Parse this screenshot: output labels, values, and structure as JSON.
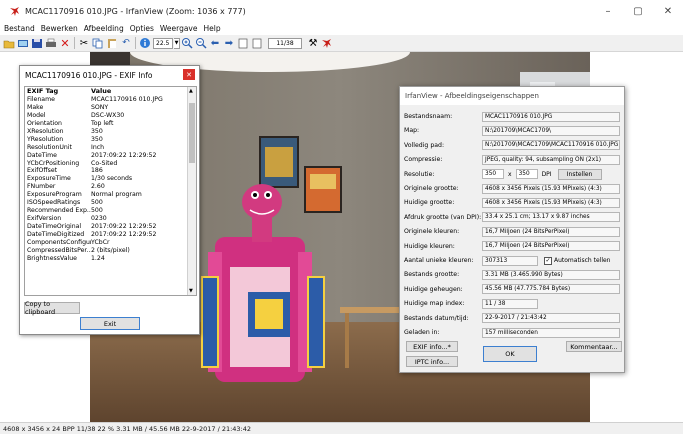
{
  "window": {
    "title": "MCAC1170916 010.JPG - IrfanView (Zoom: 1036 x 777)",
    "controls": {
      "minimize": "–",
      "maximize": "▢",
      "close": "✕"
    }
  },
  "menu": [
    "Bestand",
    "Bewerken",
    "Afbeelding",
    "Opties",
    "Weergave",
    "Help"
  ],
  "toolbar": {
    "zoom_value": "22.5",
    "page_value": "11/38",
    "icons": [
      "open-icon",
      "slideshow-icon",
      "save-icon",
      "print-icon",
      "delete-icon",
      "cut-icon",
      "copy-icon",
      "paste-icon",
      "undo-icon",
      "info-icon",
      "zoom-in-icon",
      "zoom-out-icon",
      "prev-icon",
      "next-icon",
      "first-page-icon",
      "last-page-icon",
      "settings-icon",
      "irfanview-icon"
    ]
  },
  "status_bar": "4608 x 3456 x 24 BPP   11/38  22 %   3.31 MB / 45.56 MB   22-9-2017 / 21:43:42",
  "exif_dialog": {
    "title": "MCAC1170916 010.JPG - EXIF Info",
    "col_tag": "EXIF Tag",
    "col_value": "Value",
    "rows": [
      [
        "Filename",
        "MCAC1170916 010.JPG"
      ],
      [
        "Make",
        "SONY"
      ],
      [
        "Model",
        "DSC-WX30"
      ],
      [
        "Orientation",
        "Top left"
      ],
      [
        "XResolution",
        "350"
      ],
      [
        "YResolution",
        "350"
      ],
      [
        "ResolutionUnit",
        "Inch"
      ],
      [
        "DateTime",
        "2017:09:22 12:29:52"
      ],
      [
        "YCbCrPositioning",
        "Co-Sited"
      ],
      [
        "ExifOffset",
        "186"
      ],
      [
        "ExposureTime",
        "1/30 seconds"
      ],
      [
        "FNumber",
        "2.60"
      ],
      [
        "ExposureProgram",
        "Normal program"
      ],
      [
        "ISOSpeedRatings",
        "500"
      ],
      [
        "Recommended Exp...",
        "500"
      ],
      [
        "ExifVersion",
        "0230"
      ],
      [
        "DateTimeOriginal",
        "2017:09:22 12:29:52"
      ],
      [
        "DateTimeDigitized",
        "2017:09:22 12:29:52"
      ],
      [
        "ComponentsConfigur...",
        "YCbCr"
      ],
      [
        "CompressedBitsPer...",
        "2 (bits/pixel)"
      ],
      [
        "BrightnessValue",
        "1.24"
      ]
    ],
    "copy_button": "Copy to clipboard",
    "exit_button": "Exit"
  },
  "props_dialog": {
    "title": "IrfanView - Afbeeldingseigenschappen",
    "rows": [
      {
        "label": "Bestandsnaam:",
        "value": "MCAC1170916 010.JPG"
      },
      {
        "label": "Map:",
        "value": "N:\\201709\\MCAC1709\\"
      },
      {
        "label": "Volledig pad:",
        "value": "N:\\201709\\MCAC1709\\MCAC1170916 010.JPG"
      },
      {
        "label": "Compressie:",
        "value": "JPEG, quality: 94, subsampling ON (2x1)"
      },
      {
        "label": "Resolutie:",
        "value": ""
      },
      {
        "label": "Originele grootte:",
        "value": "4608 x 3456  Pixels (15.93 MPixels) (4:3)"
      },
      {
        "label": "Huidige grootte:",
        "value": "4608 x 3456  Pixels (15.93 MPixels) (4:3)"
      },
      {
        "label": "Afdruk grootte (van DPI):",
        "value": "33.4 x 25.1 cm; 13.17 x 9.87 inches"
      },
      {
        "label": "Originele kleuren:",
        "value": "16,7 Miljoen   (24 BitsPerPixel)"
      },
      {
        "label": "Huidige kleuren:",
        "value": "16,7 Miljoen   (24 BitsPerPixel)"
      },
      {
        "label": "Aantal unieke kleuren:",
        "value": "307313"
      },
      {
        "label": "Bestands grootte:",
        "value": "3.31 MB (3.465.990 Bytes)"
      },
      {
        "label": "Huidige geheugen:",
        "value": "45.56 MB (47.775.784 Bytes)"
      },
      {
        "label": "Huidige map index:",
        "value": "11  /  38"
      },
      {
        "label": "Bestands datum/tijd:",
        "value": "22-9-2017 / 21:43:42"
      },
      {
        "label": "Geladen in:",
        "value": "157 milliseconden"
      }
    ],
    "res_x": "350",
    "res_sep": "x",
    "res_y": "350",
    "res_unit": "DPI",
    "res_button": "Instellen",
    "auto_count_label": "Automatisch tellen",
    "exif_button": "EXIF info...*",
    "iptc_button": "IPTC info...",
    "ok_button": "OK",
    "comment_button": "Kommentaar..."
  }
}
